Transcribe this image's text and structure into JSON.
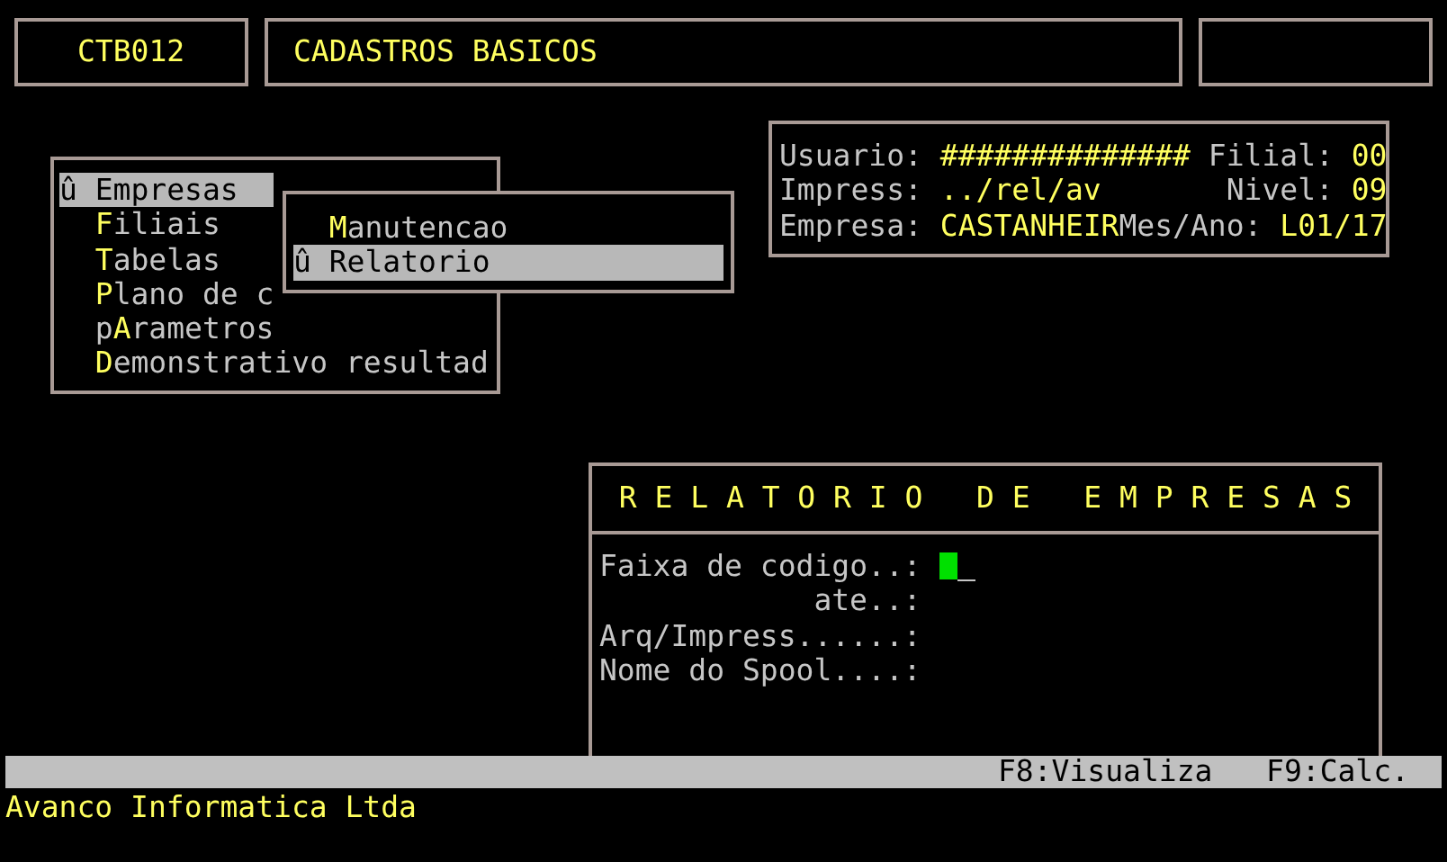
{
  "header": {
    "program_code": "CTB012",
    "title": "CADASTROS BASICOS"
  },
  "menu": {
    "items": [
      {
        "label": "Empresas",
        "selected": true,
        "marker": "û"
      },
      {
        "label": "**F**iliais",
        "selected": false
      },
      {
        "label": "**T**abelas",
        "selected": false
      },
      {
        "label": "**P**lano de c",
        "selected": false
      },
      {
        "label": "p**A**rametros",
        "selected": false
      },
      {
        "label": "**D**emonstrativo resultad",
        "selected": false
      }
    ]
  },
  "submenu": {
    "items": [
      {
        "label": "**M**anutencao",
        "selected": false
      },
      {
        "label": "Relatorio",
        "selected": true,
        "marker": "û"
      }
    ]
  },
  "info": {
    "rows": [
      {
        "label": "Usuario:",
        "value": "##############",
        "label_2": "Filial:",
        "value_2": "00"
      },
      {
        "label": "Impress:",
        "value": "../rel/av",
        "label_2": "Nivel:",
        "value_2": "09"
      },
      {
        "label": "Empresa:",
        "value": "CASTANHEIR",
        "label_2": "Mes/Ano:",
        "value_2": "L01/17"
      }
    ]
  },
  "report": {
    "title": "R E L A T O R I O   D E   E M P R E S A S",
    "fields": [
      {
        "label": "Faixa de codigo..:",
        "focused": true
      },
      {
        "label": "ate..:",
        "focused": false
      },
      {
        "label": "Arq/Impress......:",
        "focused": false
      },
      {
        "label": "Nome do Spool....:",
        "focused": false
      }
    ]
  },
  "status_bar": {
    "keys": [
      "F8:Visualiza",
      "F9:Calc."
    ]
  },
  "footer": "Avanco Informatica Ltda"
}
